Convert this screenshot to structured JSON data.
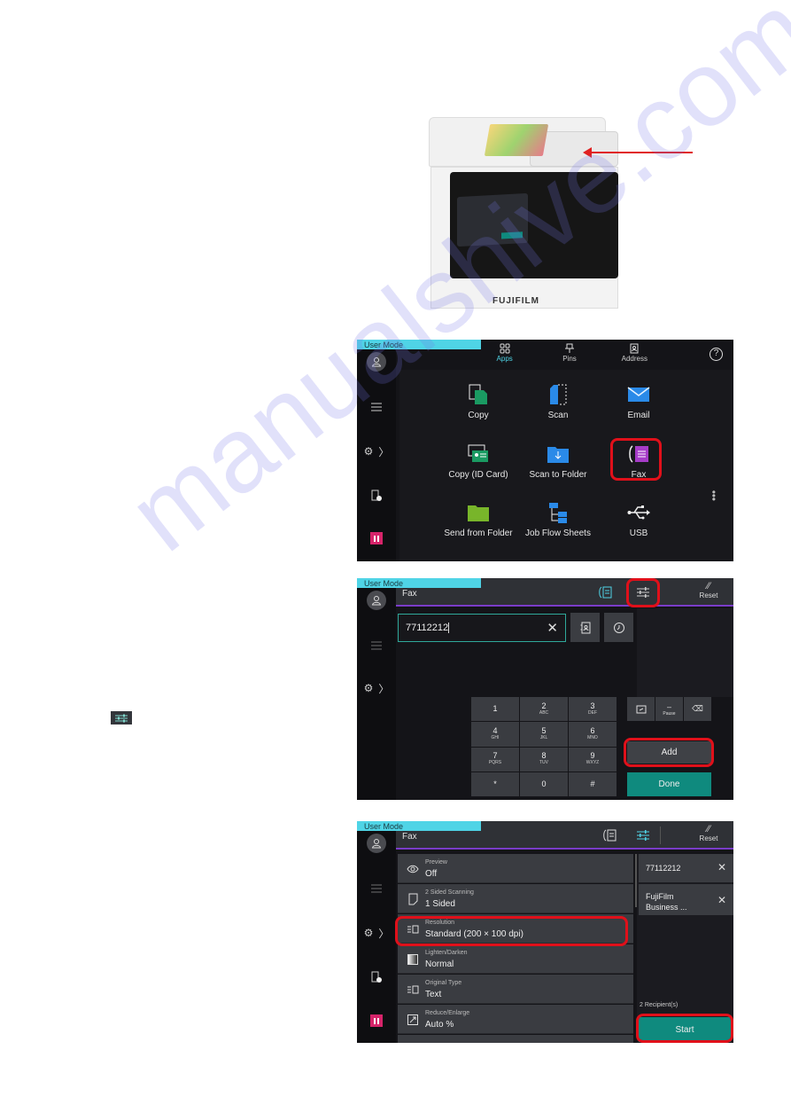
{
  "watermark": "manualshive.com",
  "printer": {
    "brand": "FUJIFILM",
    "callout_color": "#e02020"
  },
  "colors": {
    "user_mode_bar": "#4fd4e6",
    "accent_teal": "#0f8a7e",
    "highlight_red": "#e0101a",
    "pause_pink": "#d6246a",
    "header_underline": "#7a3cc8"
  },
  "common": {
    "user_mode": "User Mode"
  },
  "screen1": {
    "top_tabs": [
      {
        "label": "Apps",
        "icon": "apps-grid-icon"
      },
      {
        "label": "Pins",
        "icon": "pin-icon"
      },
      {
        "label": "Address",
        "icon": "address-book-icon"
      }
    ],
    "help_glyph": "?",
    "apps": [
      {
        "label": "Copy",
        "icon": "copy-icon"
      },
      {
        "label": "Scan",
        "icon": "scan-icon"
      },
      {
        "label": "Email",
        "icon": "email-icon"
      },
      {
        "label": "Copy (ID Card)",
        "icon": "id-card-copy-icon"
      },
      {
        "label": "Scan to Folder",
        "icon": "scan-to-folder-icon"
      },
      {
        "label": "Fax",
        "icon": "fax-icon",
        "highlighted": true
      },
      {
        "label": "Send from Folder",
        "icon": "send-from-folder-icon"
      },
      {
        "label": "Job Flow Sheets",
        "icon": "job-flow-icon"
      },
      {
        "label": "USB",
        "icon": "usb-icon"
      }
    ]
  },
  "screen2": {
    "title": "Fax",
    "reset_label": "Reset",
    "fax_number": "77112212",
    "keypad": [
      {
        "digit": "1",
        "letters": ""
      },
      {
        "digit": "2",
        "letters": "ABC"
      },
      {
        "digit": "3",
        "letters": "DEF"
      },
      {
        "digit": "4",
        "letters": "GHI"
      },
      {
        "digit": "5",
        "letters": "JKL"
      },
      {
        "digit": "6",
        "letters": "MNO"
      },
      {
        "digit": "7",
        "letters": "PQRS"
      },
      {
        "digit": "8",
        "letters": "TUV"
      },
      {
        "digit": "9",
        "letters": "WXYZ"
      },
      {
        "digit": "*",
        "letters": ""
      },
      {
        "digit": "0",
        "letters": ""
      },
      {
        "digit": "#",
        "letters": ""
      }
    ],
    "pause_label": "Pause",
    "add_label": "Add",
    "done_label": "Done"
  },
  "screen3": {
    "title": "Fax",
    "reset_label": "Reset",
    "features": [
      {
        "label": "Preview",
        "value": "Off",
        "icon": "eye-icon"
      },
      {
        "label": "2 Sided Scanning",
        "value": "1 Sided",
        "icon": "page-icon"
      },
      {
        "label": "Resolution",
        "value": "Standard (200 × 100 dpi)",
        "icon": "resolution-icon",
        "highlighted": true
      },
      {
        "label": "Lighten/Darken",
        "value": "Normal",
        "icon": "gradient-icon"
      },
      {
        "label": "Original Type",
        "value": "Text",
        "icon": "original-type-icon"
      },
      {
        "label": "Reduce/Enlarge",
        "value": "Auto %",
        "icon": "reduce-enlarge-icon"
      }
    ],
    "recipients": [
      {
        "line1": "77112212",
        "line2": ""
      },
      {
        "line1": "FujiFilm",
        "line2": "Business ..."
      }
    ],
    "recipient_count": "2 Recipient(s)",
    "start_label": "Start"
  }
}
